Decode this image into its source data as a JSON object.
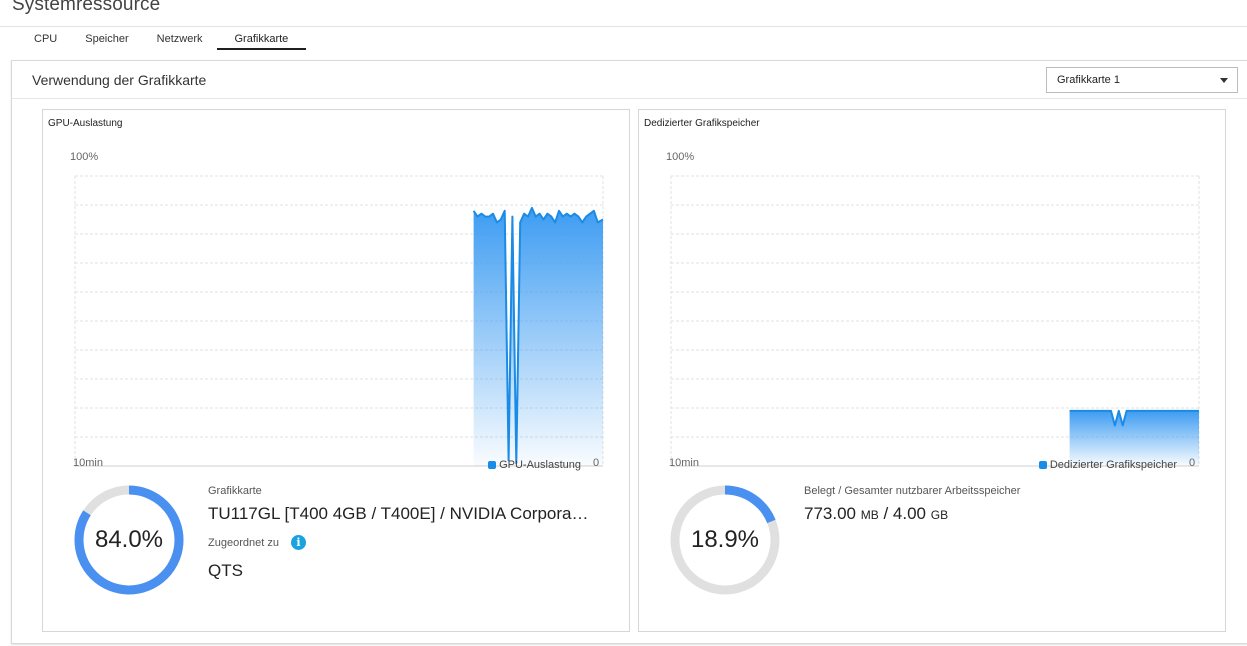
{
  "app": {
    "title": "Systemressource"
  },
  "tabs": [
    {
      "label": "CPU",
      "active": false
    },
    {
      "label": "Speicher",
      "active": false
    },
    {
      "label": "Netzwerk",
      "active": false
    },
    {
      "label": "Grafikkarte",
      "active": true
    }
  ],
  "panel": {
    "title": "Verwendung der Grafikkarte",
    "selector": {
      "selected": "Grafikkarte 1"
    }
  },
  "gpu_usage": {
    "title": "GPU-Auslastung",
    "y_max_label": "100%",
    "x_left_label": "10min",
    "x_right_label": "0",
    "legend": "GPU-Auslastung",
    "gauge_value": "84.0%",
    "gauge_fraction": 0.84,
    "card_label": "Grafikkarte",
    "card_name": "TU117GL [T400 4GB / T400E] / NVIDIA Corpora…",
    "assigned_label": "Zugeordnet zu",
    "assigned_value": "QTS"
  },
  "dedicated_memory": {
    "title": "Dedizierter Grafikspeicher",
    "y_max_label": "100%",
    "x_left_label": "10min",
    "x_right_label": "0",
    "legend": "Dedizierter Grafikspeicher",
    "gauge_value": "18.9%",
    "gauge_fraction": 0.189,
    "usage_label": "Belegt / Gesamter nutzbarer Arbeitsspeicher",
    "used_number": "773.00",
    "used_unit": "MB",
    "separator": " / ",
    "total_number": "4.00",
    "total_unit": "GB"
  },
  "colors": {
    "accent": "#1a8be6",
    "gauge_track": "#e0e0e0",
    "gauge_fill": "#4a90f0",
    "info": "#19a2e0"
  },
  "chart_data": [
    {
      "type": "area",
      "title": "GPU-Auslastung",
      "ylim": [
        0,
        100
      ],
      "grid": true,
      "legend": "bottom-right",
      "x": [
        0.0,
        0.03,
        0.06,
        0.09,
        0.12,
        0.15,
        0.18,
        0.21,
        0.24,
        0.27,
        0.3,
        0.33,
        0.36,
        0.39,
        0.42,
        0.45,
        0.48,
        0.51,
        0.54,
        0.57,
        0.6,
        0.63,
        0.66,
        0.69,
        0.72,
        0.75,
        0.78,
        0.81,
        0.84,
        0.87,
        0.9,
        0.93,
        0.96,
        1.0
      ],
      "series": [
        {
          "name": "GPU-Auslastung",
          "values": [
            88,
            86,
            87,
            86,
            86,
            87,
            84,
            85,
            88,
            2,
            86,
            1,
            84,
            87,
            86,
            89,
            86,
            87,
            85,
            87,
            86,
            84,
            88,
            86,
            87,
            86,
            87,
            86,
            84,
            86,
            87,
            88,
            84,
            85
          ]
        }
      ]
    },
    {
      "type": "area",
      "title": "Dedizierter Grafikspeicher",
      "ylim": [
        0,
        100
      ],
      "grid": true,
      "legend": "bottom-right",
      "x": [
        0.0,
        0.1,
        0.2,
        0.3,
        0.32,
        0.35,
        0.38,
        0.41,
        0.44,
        0.5,
        0.6,
        0.7,
        0.8,
        0.9,
        1.0
      ],
      "series": [
        {
          "name": "Dedizierter Grafikspeicher",
          "values": [
            19,
            19,
            19,
            19,
            19,
            14,
            19,
            14,
            19,
            19,
            19,
            19,
            19,
            19,
            19
          ]
        }
      ]
    }
  ]
}
